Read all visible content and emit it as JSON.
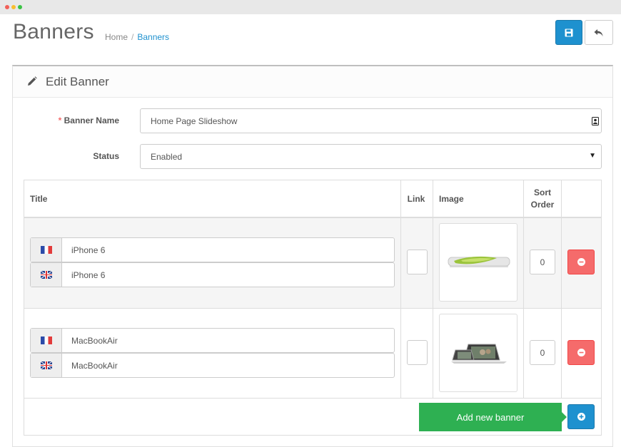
{
  "page": {
    "title": "Banners",
    "breadcrumb": [
      {
        "label": "Home"
      },
      {
        "label": "Banners"
      }
    ]
  },
  "toolbar": {
    "save_icon": "floppy-disk-icon",
    "back_icon": "reply-arrow-icon",
    "colors": {
      "primary": "#1e91cf",
      "danger": "#f56b6b",
      "success": "#2eb052"
    }
  },
  "panel": {
    "title": "Edit Banner",
    "icon": "pencil-icon"
  },
  "form": {
    "banner_name": {
      "required_mark": "*",
      "label": "Banner Name",
      "value": "Home Page Slideshow"
    },
    "status": {
      "label": "Status",
      "value": "Enabled"
    }
  },
  "table": {
    "headers": {
      "title": "Title",
      "link": "Link",
      "image": "Image",
      "sort_line1": "Sort",
      "sort_line2": "Order"
    },
    "rows": [
      {
        "titles": [
          {
            "lang": "fr",
            "value": "iPhone 6"
          },
          {
            "lang": "en-gb",
            "value": "iPhone 6"
          }
        ],
        "link": "",
        "image": "iphone-6-thumbnail",
        "sort_order": "0"
      },
      {
        "titles": [
          {
            "lang": "fr",
            "value": "MacBookAir"
          },
          {
            "lang": "en-gb",
            "value": "MacBookAir"
          }
        ],
        "link": "",
        "image": "macbook-air-thumbnail",
        "sort_order": "0"
      }
    ],
    "add_button_tooltip": "Add new banner"
  }
}
